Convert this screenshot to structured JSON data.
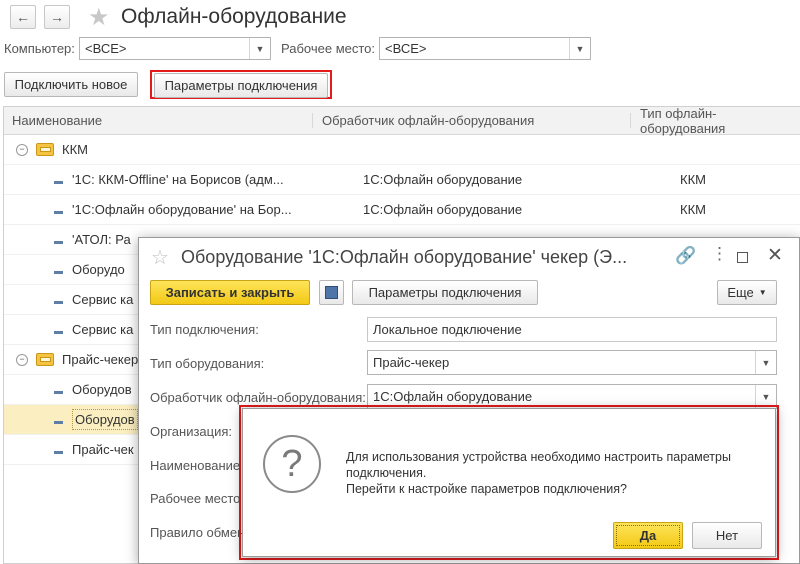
{
  "window": {
    "title": "Офлайн-оборудование"
  },
  "filters": {
    "computer_label": "Компьютер:",
    "computer_value": "<ВСЕ>",
    "workplace_label": "Рабочее место:",
    "workplace_value": "<ВСЕ>"
  },
  "toolbar": {
    "connect_new": "Подключить новое",
    "connection_params": "Параметры подключения"
  },
  "table": {
    "headers": [
      "Наименование",
      "Обработчик офлайн-оборудования",
      "Тип офлайн-оборудования"
    ],
    "groups": [
      {
        "name": "ККМ",
        "rows": [
          {
            "name": "'1С: ККМ-Offline' на Борисов (адм...",
            "handler": "1С:Офлайн оборудование",
            "type": "ККМ"
          },
          {
            "name": "'1С:Офлайн оборудование' на Бор...",
            "handler": "1С:Офлайн оборудование",
            "type": "ККМ"
          },
          {
            "name": "'АТОЛ: Ра",
            "handler": "",
            "type": ""
          },
          {
            "name": "Оборудо",
            "handler": "",
            "type": ""
          },
          {
            "name": "Сервис ка",
            "handler": "",
            "type": ""
          },
          {
            "name": "Сервис ка",
            "handler": "",
            "type": ""
          }
        ]
      },
      {
        "name": "Прайс-чекер",
        "rows": [
          {
            "name": "Оборудов",
            "handler": "",
            "type": ""
          },
          {
            "name": "Оборудов",
            "handler": "",
            "type": ""
          },
          {
            "name": "Прайс-чек",
            "handler": "",
            "type": ""
          }
        ]
      }
    ]
  },
  "dialog": {
    "title": "Оборудование '1С:Офлайн оборудование' чекер (Э...",
    "save_close": "Записать и закрыть",
    "connection_params": "Параметры подключения",
    "more": "Еще",
    "fields": {
      "conn_type_label": "Тип подключения:",
      "conn_type_value": "Локальное подключение",
      "equip_type_label": "Тип оборудования:",
      "equip_type_value": "Прайс-чекер",
      "handler_label": "Обработчик офлайн-оборудования:",
      "handler_value": "1С:Офлайн оборудование",
      "org_label": "Организация:",
      "name_label": "Наименование",
      "workplace_label": "Рабочее место",
      "exchange_label": "Правило обмен"
    }
  },
  "alert": {
    "message_line1": "Для использования устройства необходимо настроить параметры",
    "message_line2": "подключения.",
    "message_line3": "Перейти к настройке параметров подключения?",
    "yes": "Да",
    "no": "Нет"
  },
  "colors": {
    "accent_yellow": "#f6d21e",
    "highlight_red": "#e31b1b",
    "row_selected": "#fbeec0"
  }
}
